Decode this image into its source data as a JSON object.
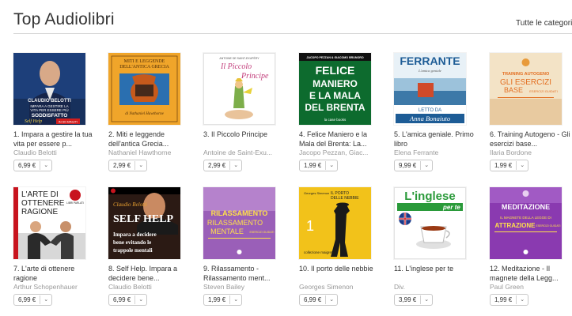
{
  "header": {
    "title": "Top Audiolibri",
    "all_link": "Tutte le categorie"
  },
  "items": [
    {
      "name": "1. Impara a gestire la tua vita per essere p...",
      "author": "Claudio Belotti",
      "price": "6,99 €",
      "cover_icon": "book-cover-image",
      "cover_text": [
        "CLAUDIO BELOTTI",
        "IMPARA A GESTIRE LA",
        "VITA PER ESSERE PIÙ",
        "SODDISFATTO",
        "Self Help",
        "IN 60 MINUTI"
      ]
    },
    {
      "name": "2. Miti e leggende dell'antica Grecia...",
      "author": "Nathaniel Hawthorne",
      "price": "2,99 €",
      "cover_icon": "book-cover-image",
      "cover_text": [
        "MITI E LEGGENDE",
        "DELL'ANTICA GRECIA",
        "di Nathaniel Hawthorne"
      ]
    },
    {
      "name": "3. Il Piccolo Principe",
      "author": "Antoine de Saint-Exu...",
      "price": "2,99 €",
      "cover_icon": "book-cover-image",
      "cover_text": [
        "ANTOINE DE SAINT-EXUPÉRY",
        "Il Piccolo",
        "Principe"
      ]
    },
    {
      "name": "4. Felice Maniero e la Mala del Brenta: La...",
      "author": "Jacopo Pezzan, Giac...",
      "price": "1,99 €",
      "cover_icon": "book-cover-image",
      "cover_text": [
        "JACOPO PEZZAN & GIACOMO BRUNORO",
        "FELICE",
        "MANIERO",
        "E LA MALA",
        "DEL BRENTA",
        "la case books"
      ]
    },
    {
      "name": "5. L'amica geniale. Primo libro",
      "author": "Elena Ferrante",
      "price": "9,99 €",
      "cover_icon": "book-cover-image",
      "cover_text": [
        "FERRANTE",
        "L'amica geniale",
        "LETTO DA",
        "Anna Bonaiuto"
      ]
    },
    {
      "name": "6. Training Autogeno - Gli esercizi base...",
      "author": "Ilaria Bordone",
      "price": "1,99 €",
      "cover_icon": "book-cover-image",
      "cover_text": [
        "TRAINING AUTOGENO",
        "GLI ESERCIZI",
        "BASE",
        "ESERCIZI GUIDATI"
      ]
    },
    {
      "name": "7. L'arte di ottenere ragione",
      "author": "Arthur Schopenhauer",
      "price": "6,99 €",
      "cover_icon": "book-cover-image",
      "cover_text": [
        "L'ARTE DI",
        "OTTENERE",
        "RAGIONE",
        "LIBRI PARLATI"
      ]
    },
    {
      "name": "8. Self Help. Impara a decidere bene...",
      "author": "Claudio Belotti",
      "price": "6,99 €",
      "cover_icon": "book-cover-image",
      "cover_text": [
        "Claudio Belotti",
        "SELF HELP",
        "Impara a decidere",
        "bene evitando le",
        "trappole mentali"
      ]
    },
    {
      "name": "9. Rilassamento - Rilassamento ment...",
      "author": "Steven Bailey",
      "price": "1,99 €",
      "cover_icon": "book-cover-image",
      "cover_text": [
        "RILASSAMENTO",
        "RILASSAMENTO",
        "MENTALE",
        "ESERCIZI GUIDATI"
      ]
    },
    {
      "name": "10. Il porto delle nebbie",
      "author": "Georges Simenon",
      "price": "6,99 €",
      "cover_icon": "book-cover-image",
      "cover_text": [
        "Georges Simenon",
        "IL PORTO",
        "DELLE NEBBIE",
        "1",
        "collezione maigret"
      ]
    },
    {
      "name": "11. L'inglese per te",
      "author": "Div.",
      "price": "3,99 €",
      "cover_icon": "book-cover-image",
      "cover_text": [
        "L'inglese",
        "per te"
      ]
    },
    {
      "name": "12. Meditazione - Il magnete della Legg...",
      "author": "Paul Green",
      "price": "1,99 €",
      "cover_icon": "book-cover-image",
      "cover_text": [
        "MEDITAZIONE",
        "IL MAGNETE DELLA LEGGE DI",
        "ATTRAZIONE",
        "ESERCIZI GUIDATI"
      ]
    }
  ],
  "icons": {
    "dropdown": "chevron-down-icon"
  }
}
